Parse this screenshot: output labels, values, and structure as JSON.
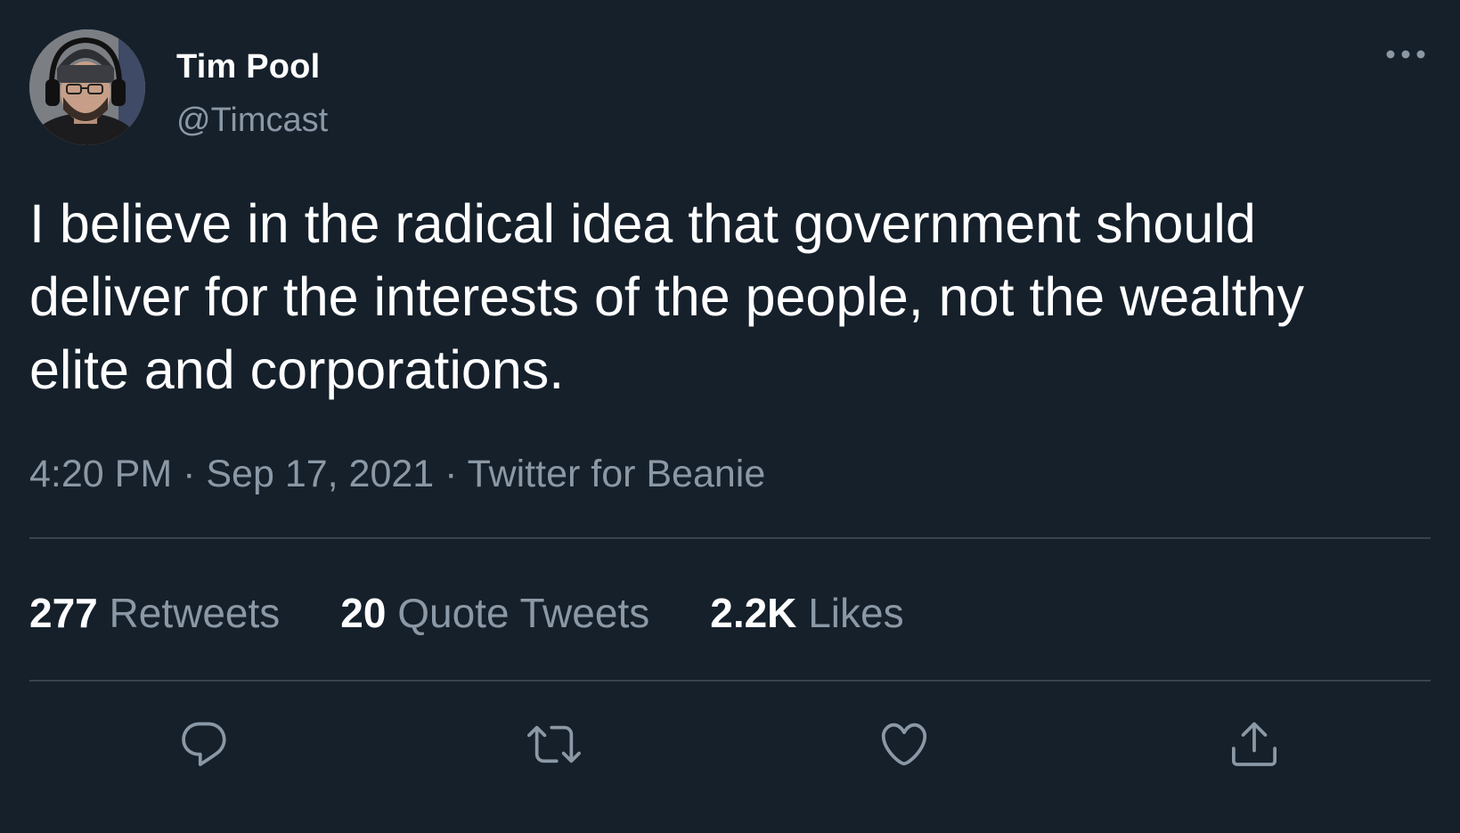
{
  "author": {
    "name": "Tim Pool",
    "handle": "@Timcast",
    "avatar_icon": "profile-photo"
  },
  "menu": {
    "icon": "more-options-icon"
  },
  "tweet": {
    "text": "I believe in the radical idea that government should\ndeliver for the interests of the people, not the wealthy\nelite and corporations.",
    "time": "4:20 PM",
    "separator": "·",
    "date": "Sep 17, 2021",
    "source": "Twitter for Beanie"
  },
  "stats": {
    "retweets_count": "277",
    "retweets_label": "Retweets",
    "quotes_count": "20",
    "quotes_label": "Quote Tweets",
    "likes_count": "2.2K",
    "likes_label": "Likes"
  },
  "actions": [
    {
      "icon": "reply-icon"
    },
    {
      "icon": "retweet-icon"
    },
    {
      "icon": "like-icon"
    },
    {
      "icon": "share-icon"
    }
  ],
  "colors": {
    "background": "#15202b",
    "primary_text": "#ffffff",
    "secondary_text": "#8b98a5",
    "divider": "#38444d"
  }
}
